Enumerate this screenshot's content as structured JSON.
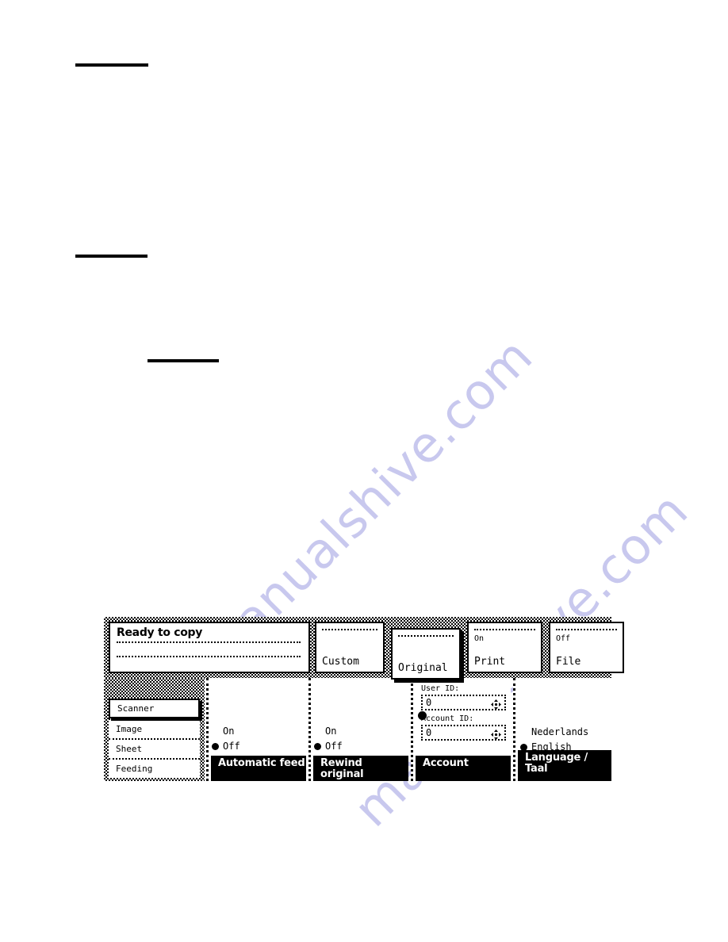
{
  "document": {
    "heading_rules": 3,
    "watermark_text": "manualshive.com",
    "watermark_color": "#c8c8ee"
  },
  "panel": {
    "status": {
      "title": "Ready to copy",
      "line_2": "",
      "line_3": ""
    },
    "mode_tiles": [
      {
        "name": "custom",
        "sublabel": "",
        "label": "Custom",
        "selected": false
      },
      {
        "name": "original",
        "sublabel": "",
        "label": "Original",
        "selected": true
      },
      {
        "name": "print",
        "sublabel": "On",
        "label": "Print",
        "selected": false
      },
      {
        "name": "file",
        "sublabel": "Off",
        "label": "File",
        "selected": false
      }
    ],
    "sidebar": {
      "tabs": [
        {
          "label": "Scanner",
          "selected": true
        },
        {
          "label": "Image",
          "selected": false
        },
        {
          "label": "Sheet",
          "selected": false
        },
        {
          "label": "Feeding",
          "selected": false
        }
      ]
    },
    "columns": {
      "automatic_feed": {
        "button_label": "Automatic feed",
        "options": [
          {
            "label": "On",
            "selected": false
          },
          {
            "label": "Off",
            "selected": true
          }
        ]
      },
      "rewind_original": {
        "button_label": "Rewind original",
        "options": [
          {
            "label": "On",
            "selected": false
          },
          {
            "label": "Off",
            "selected": true
          }
        ]
      },
      "account": {
        "button_label": "Account",
        "user_id_label": "User ID:",
        "user_id_value": "0",
        "account_id_label": "Account ID:",
        "account_id_value": "0",
        "spinner_icon": "four-way-arrow-icon"
      },
      "language": {
        "button_label": "Language /\nTaal",
        "options": [
          {
            "label": "Nederlands",
            "selected": false
          },
          {
            "label": "English",
            "selected": true
          }
        ]
      }
    }
  }
}
